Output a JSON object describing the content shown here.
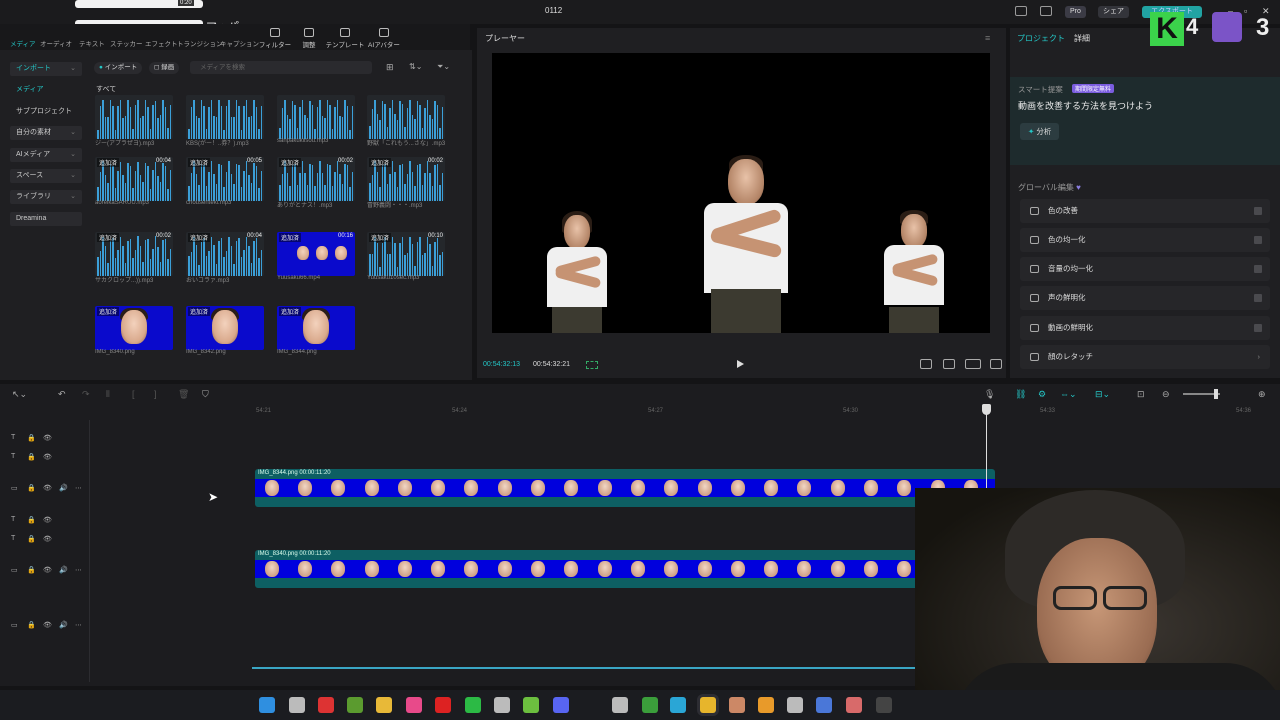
{
  "window": {
    "title": "0112"
  },
  "titlebar": {
    "pro": "Pro",
    "share": "シェア",
    "export": "エクスポート"
  },
  "overlay": {
    "map_label": "マッパー",
    "time_badge": "0:20"
  },
  "stream": {
    "k_letter": "K",
    "count_a": "4",
    "count_b": "3"
  },
  "nav": {
    "small": [
      "メディア",
      "オーディオ",
      "テキスト",
      "ステッカー",
      "エフェクト",
      "トランジション",
      "キャプション"
    ],
    "big": [
      "フィルター",
      "調整",
      "テンプレート",
      "AIアバター"
    ]
  },
  "sidebar": {
    "items": [
      {
        "label": "インポート",
        "chevron": "⌄"
      },
      {
        "label": "メディア",
        "chevron": ""
      },
      {
        "label": "サブプロジェクト",
        "chevron": ""
      },
      {
        "label": "自分の素材",
        "chevron": "⌄"
      },
      {
        "label": "AIメディア",
        "chevron": "⌄"
      },
      {
        "label": "スペース",
        "chevron": "⌄"
      },
      {
        "label": "ライブラリ",
        "chevron": "⌄"
      },
      {
        "label": "Dreamina",
        "chevron": ""
      }
    ]
  },
  "media": {
    "import_chip": "インポート",
    "record_chip": "録画",
    "search_placeholder": "メディアを検索",
    "all_label": "すべて",
    "items": [
      {
        "name": "ジー(アプラぜヨ).mp3",
        "tag": "",
        "dur": ""
      },
      {
        "name": "KBS(がー！..券？).mp3",
        "tag": "",
        "dur": ""
      },
      {
        "name": "sanpakukiisou.mp3",
        "tag": "",
        "dur": ""
      },
      {
        "name": "野獣「これもう...さな」.mp3",
        "tag": "",
        "dur": ""
      },
      {
        "name": "aoreikaSARUU.mp3",
        "tag": "追加済",
        "dur": "00:04"
      },
      {
        "name": "chousenteki.mp3",
        "tag": "追加済",
        "dur": "00:05"
      },
      {
        "name": "ありがとナス！.mp3",
        "tag": "追加済",
        "dur": "00:02"
      },
      {
        "name": "冒野義闘・・・.mp3",
        "tag": "追加済",
        "dur": "00:02"
      },
      {
        "name": "サカクロップ...)).mp3",
        "tag": "追加済",
        "dur": "00:02"
      },
      {
        "name": "おいコラァ.mp3",
        "tag": "追加済",
        "dur": "00:04"
      },
      {
        "name": "Yuusaku66.mp4",
        "tag": "追加済",
        "dur": "00:16"
      },
      {
        "name": "Yuusaku10sec.mp3",
        "tag": "追加済",
        "dur": "00:10"
      },
      {
        "name": "IMG_8340.png",
        "tag": "追加済",
        "dur": ""
      },
      {
        "name": "IMG_8342.png",
        "tag": "追加済",
        "dur": ""
      },
      {
        "name": "IMG_8344.png",
        "tag": "追加済",
        "dur": ""
      }
    ]
  },
  "player": {
    "title": "プレーヤー",
    "current_time": "00:54:32:13",
    "total_time": "00:54:32:21"
  },
  "right": {
    "tab_project": "プロジェクト",
    "tab_detail": "詳細",
    "smart_label": "スマート提案",
    "smart_badge": "期間限定無料",
    "smart_heading": "動画を改善する方法を見つけよう",
    "analyze": "分析",
    "global_label": "グローバル編集",
    "options": [
      "色の改善",
      "色の均一化",
      "音量の均一化",
      "声の鮮明化",
      "動画の鮮明化",
      "顔のレタッチ"
    ]
  },
  "timeline": {
    "ticks": [
      "54:21",
      "54:24",
      "54:27",
      "54:30",
      "54:33",
      "54:36"
    ],
    "clip1_label": "IMG_8344.png  00:00:11:20",
    "clip2_label": "IMG_8340.png  00:00:11:20"
  },
  "colors": {
    "accent": "#24c7c7",
    "clip": "#0d5f63",
    "image_bg": "#0000dd"
  }
}
